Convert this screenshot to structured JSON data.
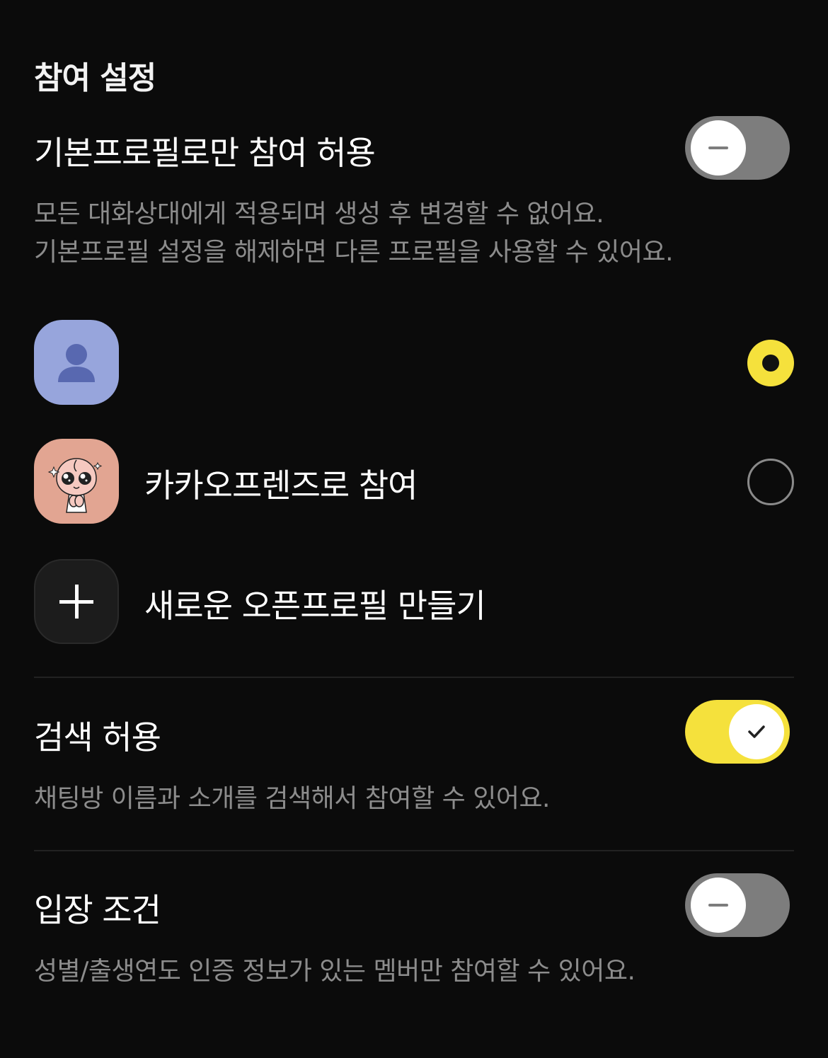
{
  "section": {
    "title": "참여 설정"
  },
  "basic_profile": {
    "title": "기본프로필로만 참여 허용",
    "toggle_state": "off",
    "description_line1": "모든 대화상대에게 적용되며 생성 후 변경할 수 없어요.",
    "description_line2": "기본프로필 설정을 해제하면 다른 프로필을 사용할 수 있어요."
  },
  "profiles": {
    "items": [
      {
        "label": "",
        "avatar_icon": "person-icon",
        "avatar_color": "#97a5dc",
        "selected": true
      },
      {
        "label": "카카오프렌즈로 참여",
        "avatar_icon": "apeach-character-icon",
        "avatar_color": "#e2a592",
        "selected": false
      },
      {
        "label": "새로운 오픈프로필 만들기",
        "avatar_icon": "plus-icon",
        "avatar_color": "#1c1c1c"
      }
    ]
  },
  "search": {
    "title": "검색 허용",
    "toggle_state": "on",
    "description": "채팅방 이름과 소개를 검색해서 참여할 수 있어요."
  },
  "entry_condition": {
    "title": "입장 조건",
    "toggle_state": "off",
    "description": "성별/출생연도 인증 정보가 있는 멤버만 참여할 수 있어요."
  },
  "colors": {
    "background": "#0b0b0b",
    "accent_yellow": "#f5e13c",
    "toggle_off": "#7d7d7d",
    "secondary_text": "#8c8c8c"
  }
}
